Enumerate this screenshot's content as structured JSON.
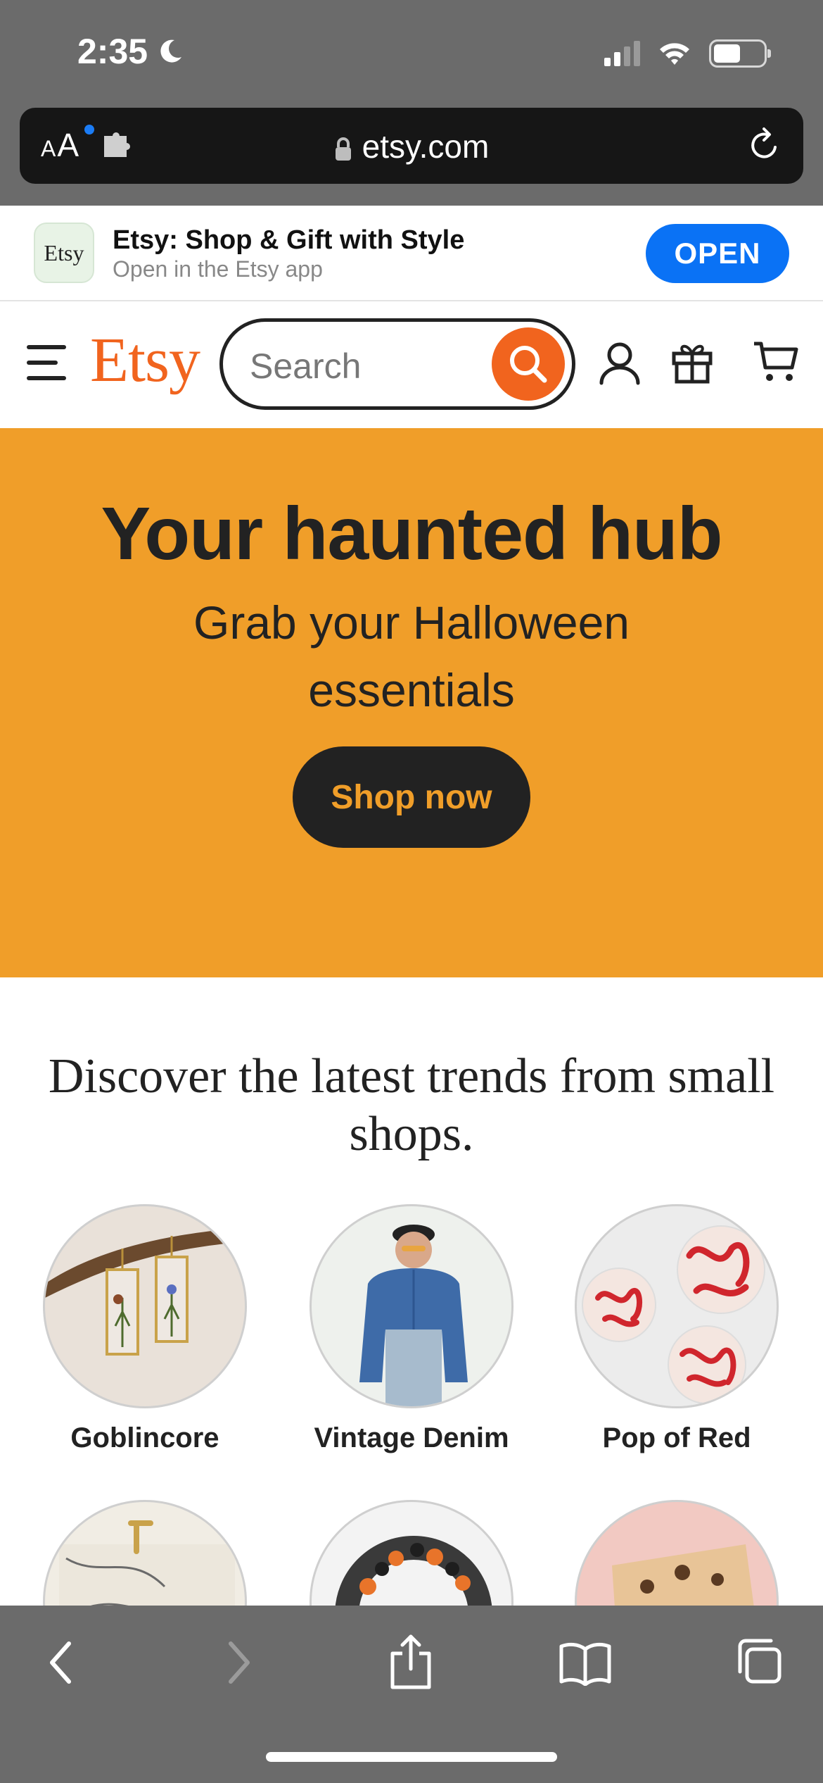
{
  "status_bar": {
    "time": "2:35"
  },
  "browser": {
    "url": "etsy.com",
    "text_size_label_small": "A",
    "text_size_label_big": "A"
  },
  "app_banner": {
    "icon_text": "Etsy",
    "title": "Etsy: Shop & Gift with Style",
    "subtitle": "Open in the Etsy app",
    "open_label": "OPEN"
  },
  "header": {
    "logo": "Etsy",
    "search_placeholder": "Search",
    "icons": [
      "menu-icon",
      "search-icon",
      "account-icon",
      "gift-icon",
      "cart-icon"
    ]
  },
  "hero": {
    "title": "Your haunted hub",
    "subtitle": "Grab your Halloween essentials",
    "cta": "Shop now",
    "background": "#f09e29"
  },
  "trends": {
    "heading": "Discover the latest trends from small shops.",
    "categories": [
      {
        "label": "Goblincore"
      },
      {
        "label": "Vintage Denim"
      },
      {
        "label": "Pop of Red"
      }
    ]
  },
  "toolbar": {
    "icons": [
      "back-icon",
      "forward-icon",
      "share-icon",
      "bookmarks-icon",
      "tabs-icon"
    ]
  },
  "colors": {
    "accent": "#f1641e",
    "ios_blue": "#0a72f5",
    "dark": "#222222"
  }
}
